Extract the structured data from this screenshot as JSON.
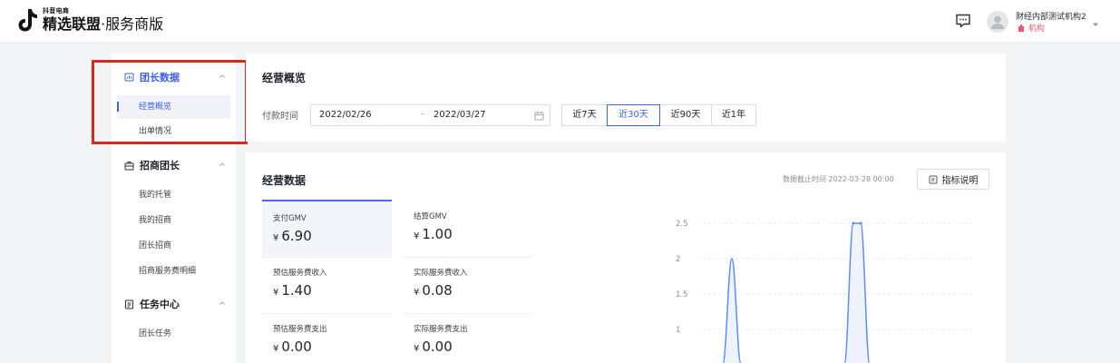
{
  "header": {
    "logo_top": "抖音电商",
    "logo_main": "精选联盟",
    "logo_suffix": "·服务商版",
    "user_name": "财经内部测试机构2",
    "user_role": "机构",
    "icons": [
      "tiktok-logo",
      "message-icon",
      "avatar",
      "chevron-down-icon"
    ]
  },
  "sidebar": {
    "groups": [
      {
        "label": "团长数据",
        "items": [
          "经营概览",
          "出单情况"
        ]
      },
      {
        "label": "招商团长",
        "items": [
          "我的托管",
          "我的招商",
          "团长招商",
          "招商服务费明细"
        ]
      },
      {
        "label": "任务中心",
        "items": [
          "团长任务"
        ]
      }
    ],
    "selected": "经营概览"
  },
  "overview": {
    "title": "经营概览",
    "pay_time_label": "付款时间",
    "date_start": "2022/02/26",
    "date_sep": "–",
    "date_end": "2022/03/27",
    "ranges": [
      "近7天",
      "近30天",
      "近90天",
      "近1年"
    ],
    "active_range": "近30天"
  },
  "business": {
    "title": "经营数据",
    "cutoff": "数据截止时间 2022-03-28 00:00",
    "explain_label": "指标说明",
    "currency": "¥",
    "metrics": [
      {
        "label": "支付GMV",
        "value": "6.90"
      },
      {
        "label": "结算GMV",
        "value": "1.00"
      },
      {
        "label": "预估服务费收入",
        "value": "1.40"
      },
      {
        "label": "实际服务费收入",
        "value": "0.08"
      },
      {
        "label": "预估服务费支出",
        "value": "0.00"
      },
      {
        "label": "实际服务费支出",
        "value": "0.00"
      }
    ]
  },
  "chart_data": {
    "type": "area",
    "y_ticks": [
      "2.5",
      "2",
      "1.5",
      "1"
    ],
    "y_tick_values": [
      2.5,
      2,
      1.5,
      1
    ],
    "ylim": [
      0.9,
      2.6
    ],
    "peaks": [
      2,
      2.5
    ],
    "grid": true,
    "line_color": "#5b8ff9",
    "fill_color": "#eef3fe"
  }
}
